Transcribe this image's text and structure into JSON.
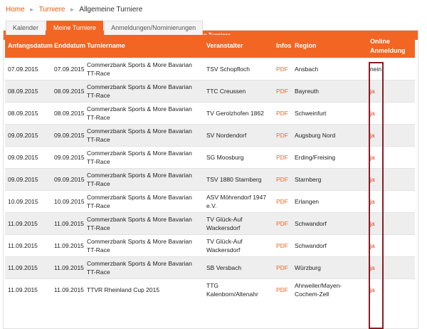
{
  "breadcrumb": {
    "home": "Home",
    "tournaments": "Turniere",
    "current": "Allgemeine Turniere"
  },
  "panel": {
    "title": "Meine Turniere"
  },
  "tabs": [
    "Kalender",
    "Meine Turniere",
    "Anmeldungen/Nominierungen"
  ],
  "table": {
    "headers": {
      "start": "Anfangsdatum",
      "end": "Enddatum",
      "name": "Turniername",
      "organizer": "Veranstalter",
      "infos": "Infos",
      "region": "Region",
      "online": "Online Anmeldung"
    },
    "rows": [
      [
        "07.09.2015",
        "07.09.2015",
        "Commerzbank Sports & More Bavarian TT-Race",
        "TSV Schopfloch",
        "PDF",
        "Ansbach",
        "nein"
      ],
      [
        "08.09.2015",
        "08.09.2015",
        "Commerzbank Sports & More Bavarian TT-Race",
        "TTC Creussen",
        "PDF",
        "Bayreuth",
        "ja"
      ],
      [
        "08.09.2015",
        "08.09.2015",
        "Commerzbank Sports & More Bavarian TT-Race",
        "TV Gerolzhofen 1862",
        "PDF",
        "Schweinfurt",
        "ja"
      ],
      [
        "09.09.2015",
        "09.09.2015",
        "Commerzbank Sports & More Bavarian TT-Race",
        "SV Nordendorf",
        "PDF",
        "Augsburg Nord",
        "ja"
      ],
      [
        "09.09.2015",
        "09.09.2015",
        "Commerzbank Sports & More Bavarian TT-Race",
        "SG Moosburg",
        "PDF",
        "Erding/Freising",
        "ja"
      ],
      [
        "09.09.2015",
        "09.09.2015",
        "Commerzbank Sports & More Bavarian TT-Race",
        "TSV 1880 Starnberg",
        "PDF",
        "Starnberg",
        "ja"
      ],
      [
        "10.09.2015",
        "10.09.2015",
        "Commerzbank Sports & More Bavarian TT-Race",
        "ASV Möhrendorf 1947 e.V.",
        "PDF",
        "Erlangen",
        "ja"
      ],
      [
        "11.09.2015",
        "11.09.2015",
        "Commerzbank Sports & More Bavarian TT-Race",
        "TV Glück-Auf Wackersdorf",
        "PDF",
        "Schwandorf",
        "ja"
      ],
      [
        "11.09.2015",
        "11.09.2015",
        "Commerzbank Sports & More Bavarian TT-Race",
        "TV Glück-Auf Wackersdorf",
        "PDF",
        "Schwandorf",
        "ja"
      ],
      [
        "11.09.2015",
        "11.09.2015",
        "Commerzbank Sports & More Bavarian TT-Race",
        "SB Versbach",
        "PDF",
        "Würzburg",
        "ja"
      ],
      [
        "11.09.2015",
        "11.09.2015",
        "TTVR Rheinland Cup 2015",
        "TTG Kalenborn/Altenahr",
        "PDF",
        "Ahrweiler/Mayen-Cochem-Zell",
        "ja"
      ]
    ]
  },
  "colors": {
    "accent": "#f26522",
    "highlight": "#8b1c24"
  }
}
